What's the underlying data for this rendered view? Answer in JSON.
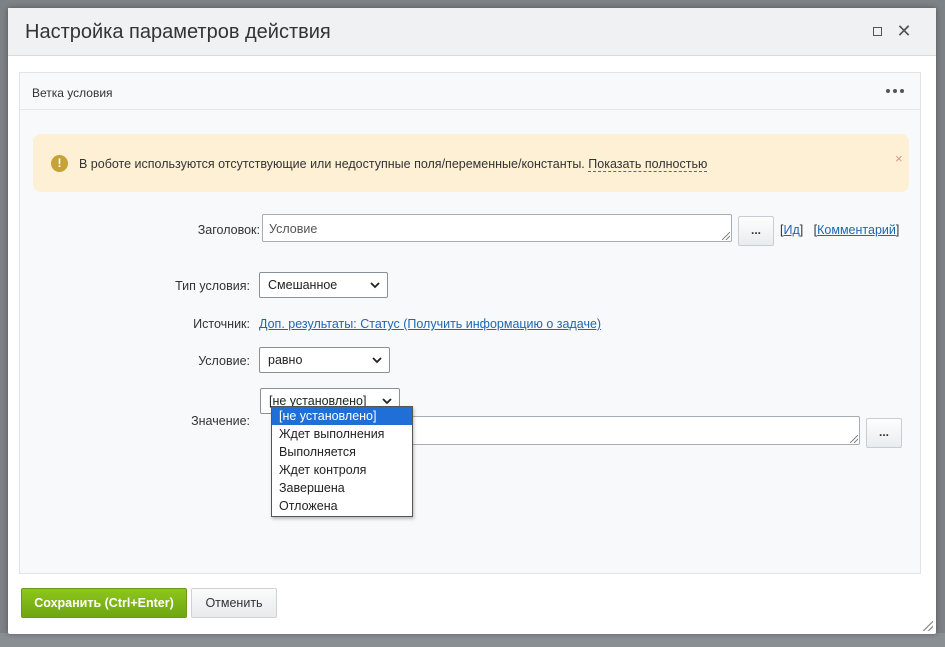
{
  "dialog": {
    "title": "Настройка параметров действия"
  },
  "panel": {
    "title": "Ветка условия"
  },
  "alert": {
    "text": "В роботе используются отсутствующие или недоступные поля/переменные/константы.",
    "link": "Показать полностью",
    "close_glyph": "×",
    "icon_glyph": "!"
  },
  "form": {
    "title_label": "Заголовок:",
    "title_value": "Условие",
    "dots_label": "...",
    "id_link": "Ид",
    "comment_link": "Комментарий",
    "condition_type_label": "Тип условия:",
    "condition_type_value": "Смешанное",
    "source_label": "Источник:",
    "source_value": "Доп. результаты: Статус (Получить информацию о задаче)",
    "condition_label": "Условие:",
    "condition_value": "равно",
    "value_label": "Значение:",
    "value_select": "[не установлено]",
    "value_options": [
      "[не установлено]",
      "Ждет выполнения",
      "Выполняется",
      "Ждет контроля",
      "Завершена",
      "Отложена"
    ],
    "value_dots_label": "..."
  },
  "footer": {
    "save_label": "Сохранить (Ctrl+Enter)",
    "cancel_label": "Отменить"
  },
  "colors": {
    "accent_green": "#7ab316",
    "link_blue": "#2067b0",
    "alert_bg": "#fdf0d5",
    "selected_option": "#1f6fd6"
  }
}
